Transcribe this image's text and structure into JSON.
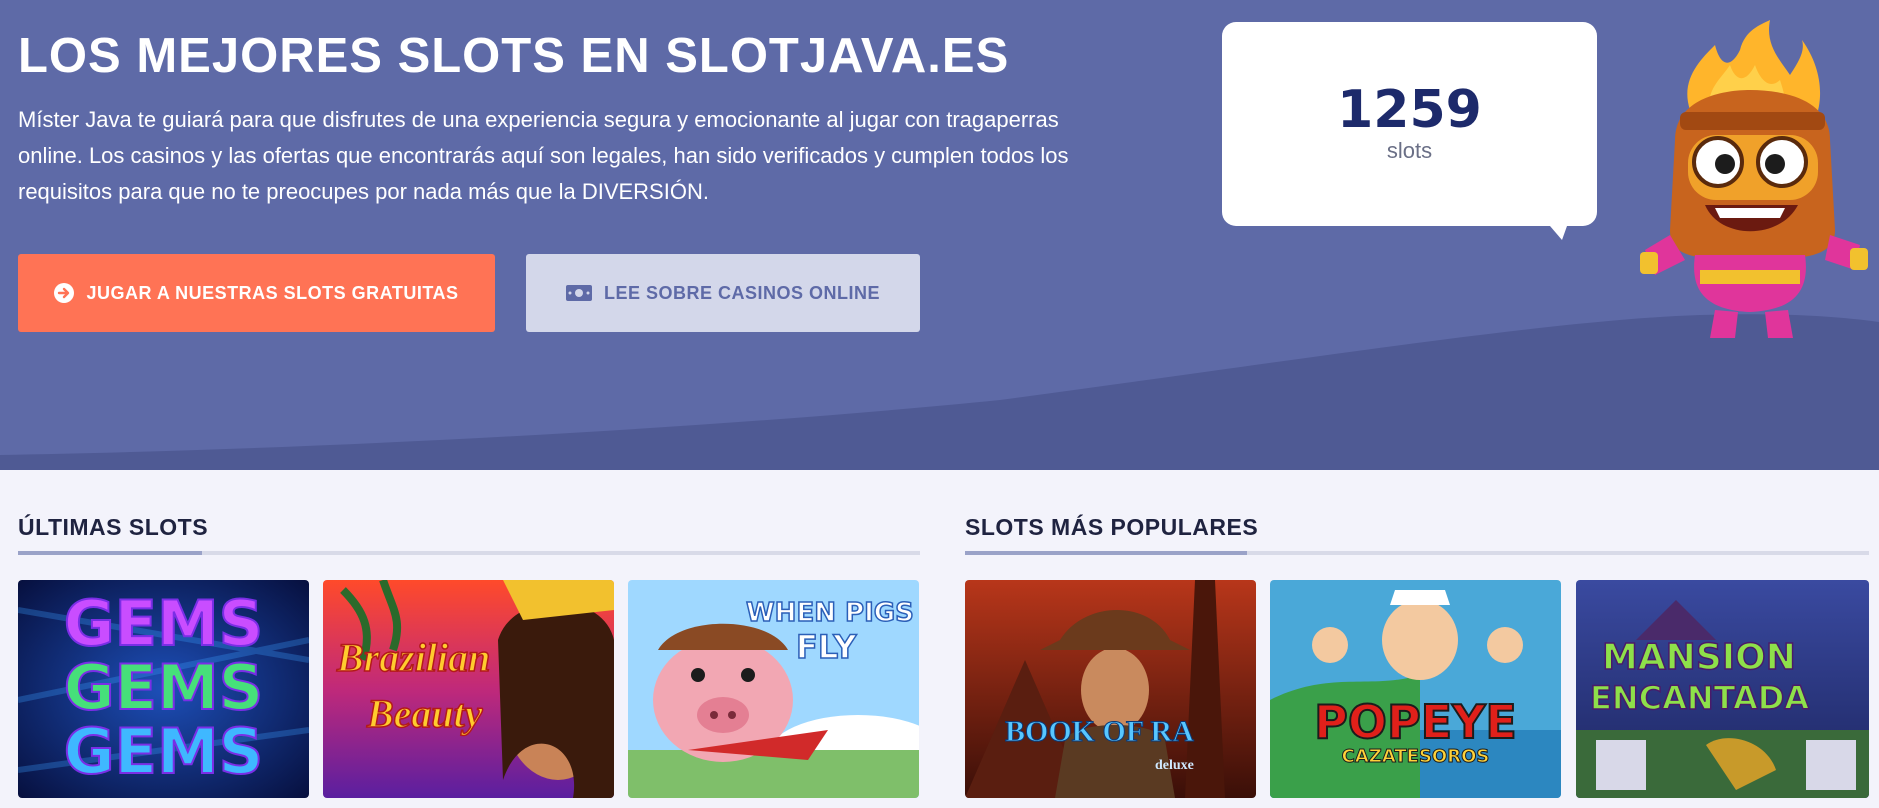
{
  "hero": {
    "title": "LOS MEJORES SLOTS EN SLOTJAVA.ES",
    "description": "Míster Java te guiará para que disfrutes de una experiencia segura y emocionante al jugar con tragaperras online. Los casinos y las ofertas que encontrarás aquí son legales, han sido verificados y cumplen todos los requisitos para que no te preocupes por nada más que la DIVERSIÓN.",
    "primary_button": "JUGAR A NUESTRAS SLOTS GRATUITAS",
    "secondary_button": "LEE SOBRE CASINOS ONLINE",
    "counter": {
      "value": "1259",
      "unit": "slots"
    },
    "colors": {
      "background": "#5e6aa7",
      "primary": "#ff7355",
      "secondary": "#d3d7ea"
    }
  },
  "latest": {
    "title": "ÚLTIMAS SLOTS",
    "games": [
      {
        "name": "GEMS GEMS GEMS",
        "logo_lines": [
          "GEMS",
          "GEMS",
          "GEMS"
        ]
      },
      {
        "name": "Brazilian Beauty",
        "logo_lines": [
          "Brazilian",
          "Beauty"
        ]
      },
      {
        "name": "When Pigs Fly",
        "logo_lines": [
          "WHEN PIGS",
          "FLY"
        ]
      }
    ]
  },
  "popular": {
    "title": "SLOTS MÁS POPULARES",
    "games": [
      {
        "name": "Book of Ra deluxe",
        "logo_lines": [
          "BOOK OF RA",
          "deluxe"
        ]
      },
      {
        "name": "Popeye Cazatesoros",
        "logo_lines": [
          "POPEYE",
          "CAZATESOROS"
        ]
      },
      {
        "name": "Mansion Encantada",
        "logo_lines": [
          "MANSION",
          "ENCANTADA"
        ]
      }
    ]
  }
}
